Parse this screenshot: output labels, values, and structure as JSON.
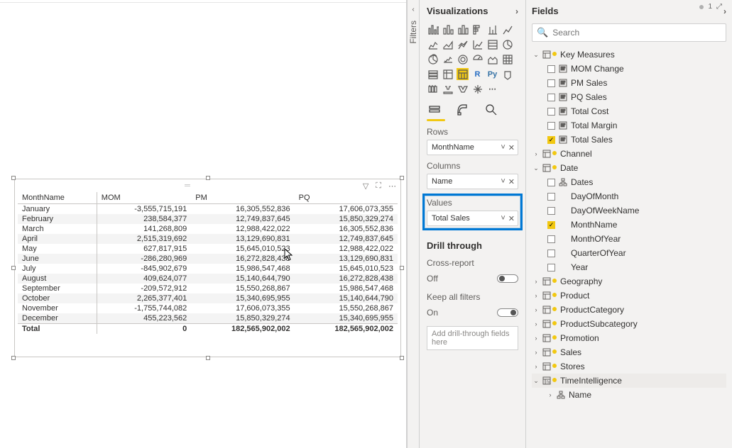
{
  "chart_data": {
    "type": "table",
    "columns": [
      "MonthName",
      "MOM",
      "PM",
      "PQ"
    ],
    "rows": [
      {
        "month": "January",
        "mom": "-3,555,715,191",
        "pm": "16,305,552,836",
        "pq": "17,606,073,355"
      },
      {
        "month": "February",
        "mom": "238,584,377",
        "pm": "12,749,837,645",
        "pq": "15,850,329,274"
      },
      {
        "month": "March",
        "mom": "141,268,809",
        "pm": "12,988,422,022",
        "pq": "16,305,552,836"
      },
      {
        "month": "April",
        "mom": "2,515,319,692",
        "pm": "13,129,690,831",
        "pq": "12,749,837,645"
      },
      {
        "month": "May",
        "mom": "627,817,915",
        "pm": "15,645,010,523",
        "pq": "12,988,422,022"
      },
      {
        "month": "June",
        "mom": "-286,280,969",
        "pm": "16,272,828,438",
        "pq": "13,129,690,831"
      },
      {
        "month": "July",
        "mom": "-845,902,679",
        "pm": "15,986,547,468",
        "pq": "15,645,010,523"
      },
      {
        "month": "August",
        "mom": "409,624,077",
        "pm": "15,140,644,790",
        "pq": "16,272,828,438"
      },
      {
        "month": "September",
        "mom": "-209,572,912",
        "pm": "15,550,268,867",
        "pq": "15,986,547,468"
      },
      {
        "month": "October",
        "mom": "2,265,377,401",
        "pm": "15,340,695,955",
        "pq": "15,140,644,790"
      },
      {
        "month": "November",
        "mom": "-1,755,744,082",
        "pm": "17,606,073,355",
        "pq": "15,550,268,867"
      },
      {
        "month": "December",
        "mom": "455,223,562",
        "pm": "15,850,329,274",
        "pq": "15,340,695,955"
      }
    ],
    "total": {
      "month": "Total",
      "mom": "0",
      "pm": "182,565,902,002",
      "pq": "182,565,902,002"
    }
  },
  "panels": {
    "filters_label": "Filters",
    "viz_title": "Visualizations",
    "fields_title": "Fields",
    "search_placeholder": "Search",
    "rows_label": "Rows",
    "rows_value": "MonthName",
    "columns_label": "Columns",
    "columns_value": "Name",
    "values_label": "Values",
    "values_value": "Total Sales",
    "drill_title": "Drill through",
    "cross_report": "Cross-report",
    "cross_report_state": "Off",
    "keep_filters": "Keep all filters",
    "keep_filters_state": "On",
    "drill_placeholder": "Add drill-through fields here"
  },
  "fields_tree": {
    "key_measures": {
      "name": "Key Measures",
      "items": [
        {
          "label": "MOM Change",
          "checked": false
        },
        {
          "label": "PM Sales",
          "checked": false
        },
        {
          "label": "PQ Sales",
          "checked": false
        },
        {
          "label": "Total Cost",
          "checked": false
        },
        {
          "label": "Total Margin",
          "checked": false
        },
        {
          "label": "Total Sales",
          "checked": true
        }
      ]
    },
    "channel": "Channel",
    "date": {
      "name": "Date",
      "items": [
        {
          "label": "Dates",
          "checked": false,
          "hierarchy": true
        },
        {
          "label": "DayOfMonth",
          "checked": false
        },
        {
          "label": "DayOfWeekName",
          "checked": false
        },
        {
          "label": "MonthName",
          "checked": true
        },
        {
          "label": "MonthOfYear",
          "checked": false
        },
        {
          "label": "QuarterOfYear",
          "checked": false
        },
        {
          "label": "Year",
          "checked": false
        }
      ]
    },
    "geography": "Geography",
    "product": "Product",
    "product_category": "ProductCategory",
    "product_subcategory": "ProductSubcategory",
    "promotion": "Promotion",
    "sales": "Sales",
    "stores": "Stores",
    "time_intelligence": {
      "name": "TimeIntelligence",
      "child": "Name"
    }
  }
}
